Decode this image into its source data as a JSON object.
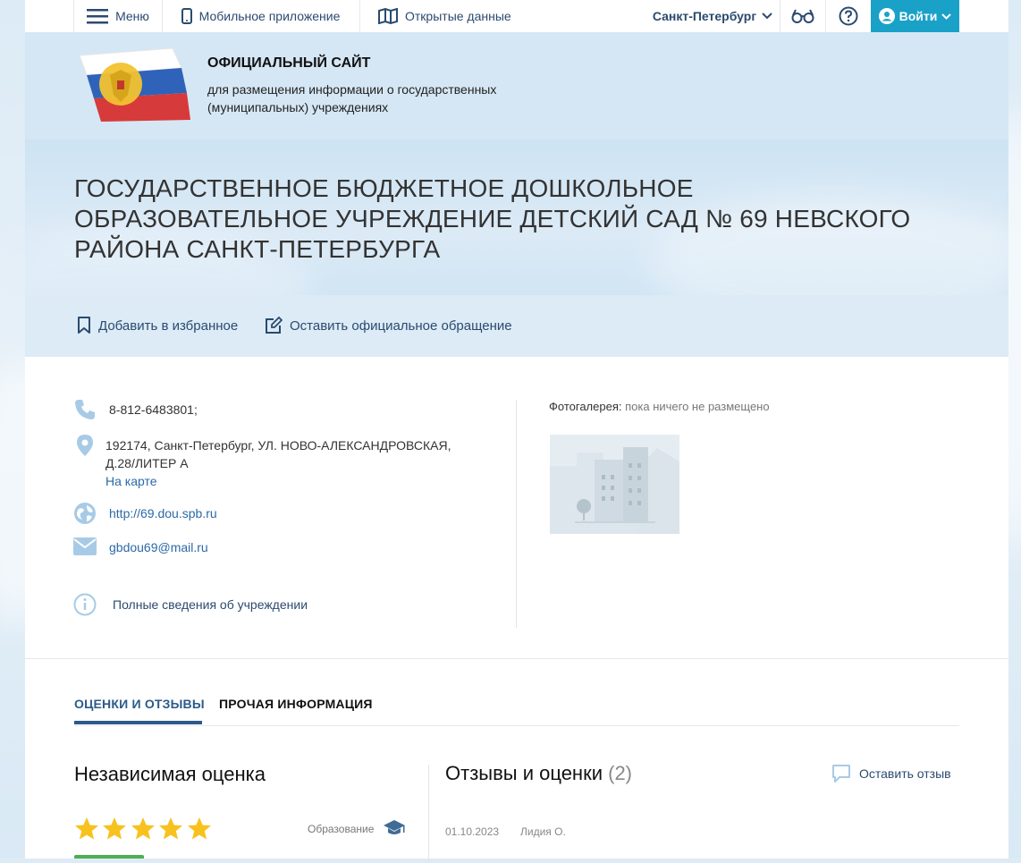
{
  "topbar": {
    "menu_label": "Меню",
    "mobile_app_label": "Мобильное приложение",
    "open_data_label": "Открытые данные",
    "region_label": "Санкт-Петербург",
    "login_label": "Войти"
  },
  "header": {
    "title": "ОФИЦИАЛЬНЫЙ САЙТ",
    "subtitle": "для размещения информации о государственных (муниципальных) учреждениях"
  },
  "hero": {
    "institution_name": "ГОСУДАРСТВЕННОЕ БЮДЖЕТНОЕ ДОШКОЛЬНОЕ ОБРАЗОВАТЕЛЬНОЕ УЧРЕЖДЕНИЕ ДЕТСКИЙ САД № 69 НЕВСКОГО РАЙОНА САНКТ-ПЕТЕРБУРГА"
  },
  "actions": {
    "favorite_label": "Добавить в избранное",
    "appeal_label": "Оставить официальное обращение"
  },
  "contacts": {
    "phone": "8-812-6483801;",
    "address_line1": "192174, Санкт-Петербург, УЛ. НОВО-АЛЕКСАНДРОВСКАЯ,",
    "address_line2": "Д.28/ЛИТЕР А",
    "map_link": "На карте",
    "website": "http://69.dou.spb.ru",
    "email": "gbdou69@mail.ru",
    "full_info_link": "Полные сведения об учреждении"
  },
  "gallery": {
    "label": "Фотогалерея:",
    "empty_text": "пока ничего не размещено"
  },
  "tabs": [
    {
      "label": "ОЦЕНКИ И ОТЗЫВЫ",
      "active": true
    },
    {
      "label": "ПРОЧАЯ ИНФОРМАЦИЯ",
      "active": false
    }
  ],
  "independent_rating": {
    "heading": "Независимая оценка",
    "stars": 5,
    "max_stars": 5,
    "category_label": "Образование"
  },
  "reviews": {
    "heading": "Отзывы и оценки",
    "count_display": "(2)",
    "leave_review_label": "Оставить отзыв",
    "items": [
      {
        "date": "01.10.2023",
        "author": "Лидия О."
      }
    ]
  },
  "colors": {
    "accent": "#1aa1c8",
    "link": "#2b6aa6",
    "star": "#f7c21d",
    "tab_active": "#2b5a8a"
  }
}
